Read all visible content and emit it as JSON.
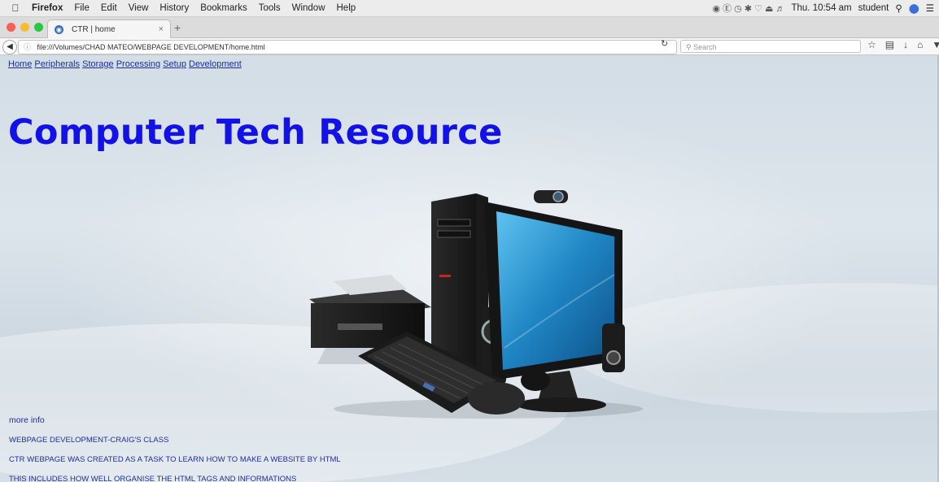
{
  "menubar": {
    "app": "Firefox",
    "items": [
      "File",
      "Edit",
      "View",
      "History",
      "Bookmarks",
      "Tools",
      "Window",
      "Help"
    ],
    "clock": "Thu. 10:54 am",
    "user": "student"
  },
  "tab": {
    "title": "CTR | home"
  },
  "navbar": {
    "url": "file:///Volumes/CHAD MATEO/WEBPAGE DEVELOPMENT/home.html",
    "search_placeholder": "Search"
  },
  "page": {
    "nav": [
      "Home",
      "Peripherals",
      "Storage",
      "Processing",
      "Setup",
      "Development"
    ],
    "title": "Computer Tech Resource",
    "more_info": "more info",
    "lines": [
      "WEBPAGE DEVELOPMENT-CRAIG'S CLASS",
      "CTR WEBPAGE WAS CREATED AS A TASK TO LEARN HOW TO MAKE A WEBSITE BY HTML",
      "THIS INCLUDES HOW WELL ORGANISE THE HTML TAGS AND INFORMATIONS"
    ]
  },
  "colors": {
    "title": "#1212e8",
    "link": "#1d2f9a",
    "monitor_screen": "#1f86c4"
  }
}
